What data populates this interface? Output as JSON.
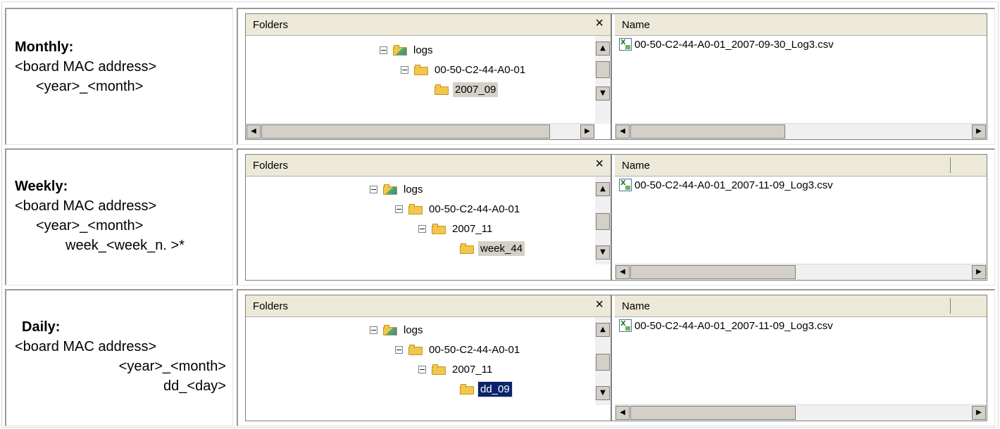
{
  "rows": [
    {
      "label": "Monthly:",
      "lines": [
        "<board MAC address>",
        "<year>_<month>"
      ],
      "folders_title": "Folders",
      "close": "×",
      "tree": [
        "logs",
        "00-50-C2-44-A0-01",
        "2007_09"
      ],
      "selected": "2007_09",
      "name_header": "Name",
      "file": "00-50-C2-44-A0-01_2007-09-30_Log3.csv"
    },
    {
      "label": "Weekly:",
      "lines": [
        "<board MAC address>",
        "<year>_<month>",
        "week_<week_n. >*"
      ],
      "folders_title": "Folders",
      "close": "×",
      "tree": [
        "logs",
        "00-50-C2-44-A0-01",
        "2007_11",
        "week_44"
      ],
      "selected": "week_44",
      "name_header": "Name",
      "file": "00-50-C2-44-A0-01_2007-11-09_Log3.csv"
    },
    {
      "label": "Daily:",
      "lines": [
        "<board MAC address>",
        "<year>_<month>",
        "dd_<day>"
      ],
      "folders_title": "Folders",
      "close": "×",
      "tree": [
        "logs",
        "00-50-C2-44-A0-01",
        "2007_11",
        "dd_09"
      ],
      "selected": "dd_09",
      "name_header": "Name",
      "file": "00-50-C2-44-A0-01_2007-11-09_Log3.csv"
    }
  ],
  "icons": {
    "expander": "−",
    "up_arrow": "▲",
    "down_arrow": "▼",
    "left_arrow": "◀",
    "right_arrow": "▶"
  }
}
